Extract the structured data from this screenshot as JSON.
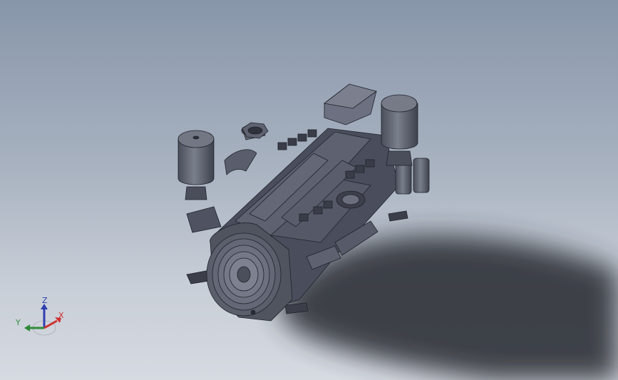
{
  "viewport": {
    "background_top": "#8896aa",
    "background_bottom": "#d6dae1",
    "model_color": "#4a4e5c"
  },
  "triad": {
    "x_label": "X",
    "y_label": "Y",
    "z_label": "Z",
    "x_color": "#d03030",
    "y_color": "#2e8b3a",
    "z_color": "#2f3fb0"
  }
}
